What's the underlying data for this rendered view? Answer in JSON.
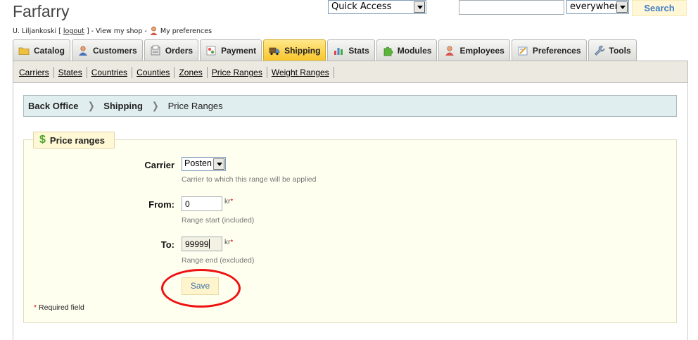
{
  "header": {
    "shop_name": "Farfarry",
    "user_name": "U. Liljankoski",
    "logout_label": "logout",
    "view_shop_label": "View my shop",
    "preferences_label": "My preferences",
    "quick_access": "Quick Access",
    "search_value": "",
    "search_scope": "everywhere",
    "search_button": "Search"
  },
  "tabs": [
    {
      "label": "Catalog",
      "icon": "folder-icon"
    },
    {
      "label": "Customers",
      "icon": "customers-icon"
    },
    {
      "label": "Orders",
      "icon": "orders-icon"
    },
    {
      "label": "Payment",
      "icon": "payment-icon"
    },
    {
      "label": "Shipping",
      "icon": "truck-icon",
      "active": true
    },
    {
      "label": "Stats",
      "icon": "chart-icon"
    },
    {
      "label": "Modules",
      "icon": "puzzle-icon"
    },
    {
      "label": "Employees",
      "icon": "employee-icon"
    },
    {
      "label": "Preferences",
      "icon": "preferences-icon"
    },
    {
      "label": "Tools",
      "icon": "wrench-icon"
    }
  ],
  "subnav": [
    "Carriers",
    "States",
    "Countries",
    "Counties",
    "Zones",
    "Price Ranges",
    "Weight Ranges"
  ],
  "breadcrumb": {
    "root": "Back Office",
    "section": "Shipping",
    "page": "Price Ranges"
  },
  "form": {
    "legend": "Price ranges",
    "carrier": {
      "label": "Carrier",
      "value": "Posten",
      "hint": "Carrier to which this range will be applied"
    },
    "from": {
      "label": "From:",
      "value": "0",
      "unit": "kr",
      "hint": "Range start (included)"
    },
    "to": {
      "label": "To:",
      "value": "99999",
      "unit": "kr",
      "hint": "Range end (excluded)"
    },
    "save_label": "Save",
    "required_note": "Required field"
  },
  "colors": {
    "active_tab": "#f9c62a",
    "highlight_circle": "#e11111",
    "required": "#dd0000"
  }
}
